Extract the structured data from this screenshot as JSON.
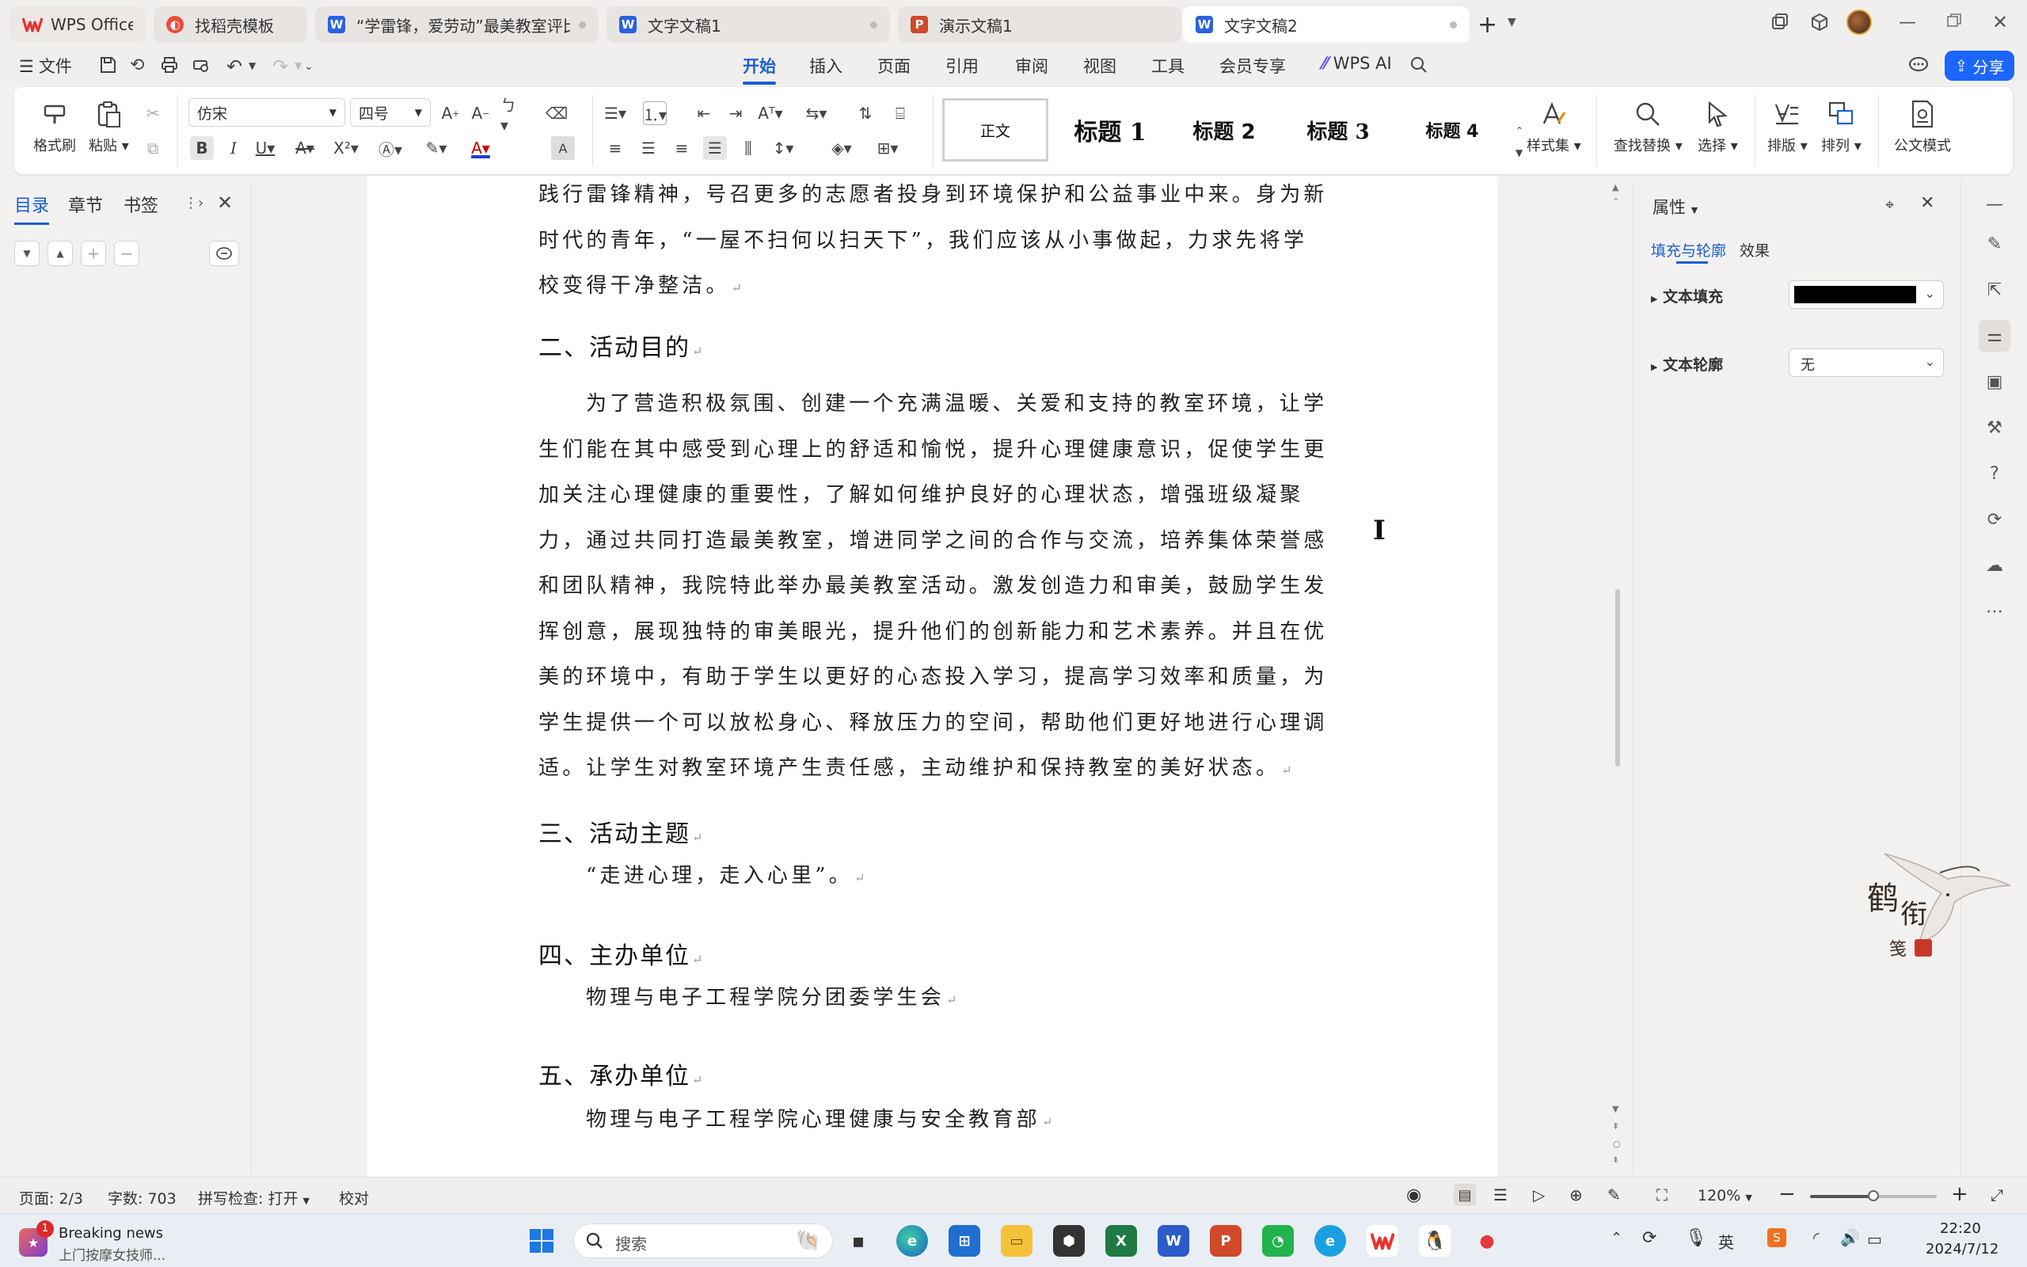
{
  "tabs": [
    {
      "label": "WPS Office",
      "icon": "wps-logo-icon"
    },
    {
      "label": "找稻壳模板",
      "icon": "docer-icon"
    },
    {
      "label": "“学雷锋，爱劳动”最美教室评比…",
      "icon": "word-doc-icon"
    },
    {
      "label": "文字文稿1",
      "icon": "word-doc-icon"
    },
    {
      "label": "演示文稿1",
      "icon": "ppt-doc-icon"
    },
    {
      "label": "文字文稿2",
      "icon": "word-doc-icon",
      "active": true
    }
  ],
  "menu": {
    "file_label": "文件",
    "items": [
      "开始",
      "插入",
      "页面",
      "引用",
      "审阅",
      "视图",
      "工具",
      "会员专享"
    ],
    "active": "开始",
    "wps_ai": "WPS AI",
    "share": "分享"
  },
  "ribbon": {
    "format_painter": "格式刷",
    "paste": "粘贴",
    "font_name": "仿宋",
    "font_size": "四号",
    "styles": [
      "正文",
      "标题 1",
      "标题 2",
      "标题 3",
      "标题 4"
    ],
    "style_set": "样式集",
    "find_replace": "查找替换",
    "select": "选择",
    "layout": "排版",
    "arrange": "排列",
    "official_mode": "公文模式"
  },
  "left_panel": {
    "tabs": [
      "目录",
      "章节",
      "书签"
    ],
    "active": "目录"
  },
  "document": {
    "intro_text": "践行雷锋精神，号召更多的志愿者投身到环境保护和公益事业中来。身为新时代的青年，“一屋不扫何以扫天下”，我们应该从小事做起，力求先将学校变得干净整洁。",
    "h2": "二、活动目的",
    "p2": "为了营造积极氛围、创建一个充满温暖、关爱和支持的教室环境，让学生们能在其中感受到心理上的舒适和愉悦，提升心理健康意识，促使学生更加关注心理健康的重要性，了解如何维护良好的心理状态，增强班级凝聚力，通过共同打造最美教室，增进同学之间的合作与交流，培养集体荣誉感和团队精神，我院特此举办最美教室活动。激发创造力和审美，鼓励学生发挥创意，展现独特的审美眼光，提升他们的创新能力和艺术素养。并且在优美的环境中，有助于学生以更好的心态投入学习，提高学习效率和质量，为学生提供一个可以放松身心、释放压力的空间，帮助他们更好地进行心理调适。让学生对教室环境产生责任感，主动维护和保持教室的美好状态。",
    "h3": "三、活动主题",
    "p3": "“走进心理，走入心里”。",
    "h4": "四、主办单位",
    "p4": "物理与电子工程学院分团委学生会",
    "h5": "五、承办单位",
    "p5": "物理与电子工程学院心理健康与安全教育部"
  },
  "properties": {
    "title": "属性",
    "tabs": [
      "填充与轮廓",
      "效果"
    ],
    "active_tab": "填充与轮廓",
    "text_fill_label": "文本填充",
    "text_fill_color": "#000000",
    "text_outline_label": "文本轮廓",
    "text_outline_value": "无"
  },
  "status": {
    "page": "页面: 2/3",
    "words": "字数: 703",
    "spell": "拼写检查: 打开",
    "proof": "校对",
    "zoom": "120%",
    "zoom_fraction": 0.5
  },
  "taskbar": {
    "news_title": "Breaking news",
    "news_sub": "上门按摩女技师...",
    "news_badge": "1",
    "search_placeholder": "搜索",
    "time": "22:20",
    "date": "2024/7/12",
    "ime": "英"
  },
  "colors": {
    "accent": "#1a5fd0",
    "share_bg": "#1a66ff",
    "wps_red": "#e8322e",
    "word_blue": "#2b61e0",
    "ppt_orange": "#d0492a"
  }
}
